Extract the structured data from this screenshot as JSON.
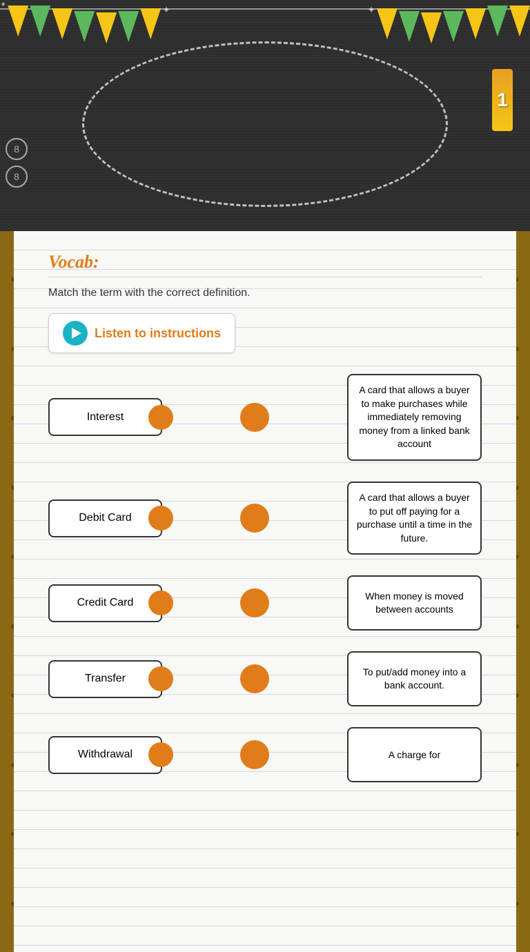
{
  "chalkboard": {
    "title": ""
  },
  "page": {
    "vocab_label": "Vocab:",
    "instruction": "Match the term with the correct definition.",
    "listen_label": "Listen to instructions"
  },
  "terms": [
    {
      "id": "interest",
      "label": "Interest"
    },
    {
      "id": "debit-card",
      "label": "Debit Card"
    },
    {
      "id": "credit-card",
      "label": "Credit Card"
    },
    {
      "id": "transfer",
      "label": "Transfer"
    },
    {
      "id": "withdrawal",
      "label": "Withdrawal"
    }
  ],
  "definitions": [
    {
      "id": "def1",
      "text": "A card that allows a buyer to make purchases while immediately removing money from a linked bank account"
    },
    {
      "id": "def2",
      "text": "A card that allows a buyer to put off paying for a purchase until a time in the future."
    },
    {
      "id": "def3",
      "text": "When money is moved between accounts"
    },
    {
      "id": "def4",
      "text": "To put/add money into a bank account."
    },
    {
      "id": "def5",
      "text": "A charge for"
    }
  ],
  "ruler": {
    "number": "1"
  }
}
